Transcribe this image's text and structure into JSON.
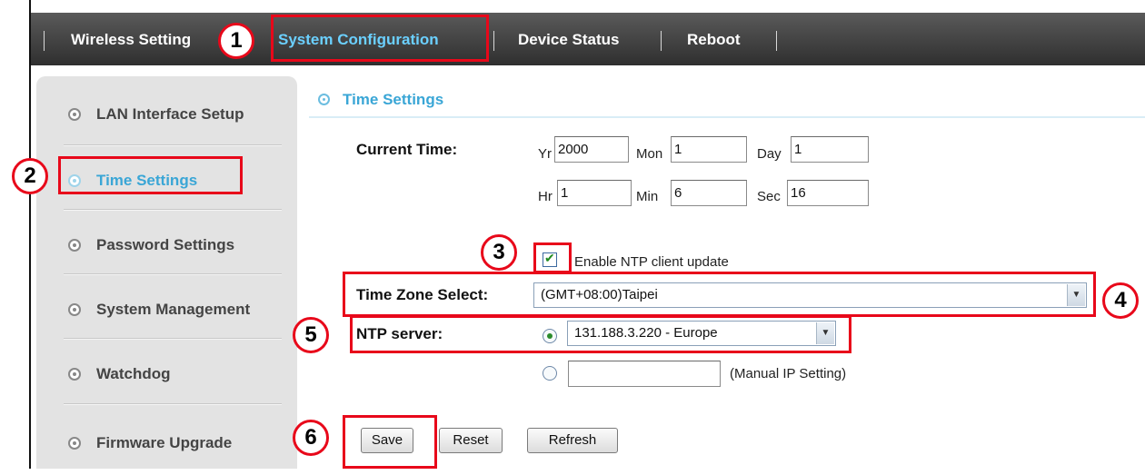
{
  "nav": {
    "items": [
      {
        "label": "Wireless Setting"
      },
      {
        "label": "System Configuration",
        "active": true
      },
      {
        "label": "Device Status"
      },
      {
        "label": "Reboot"
      }
    ]
  },
  "sidebar": {
    "items": [
      {
        "label": "LAN Interface Setup"
      },
      {
        "label": "Time Settings",
        "active": true
      },
      {
        "label": "Password Settings"
      },
      {
        "label": "System Management"
      },
      {
        "label": "Watchdog"
      },
      {
        "label": "Firmware Upgrade"
      }
    ]
  },
  "main": {
    "section_title": "Time Settings",
    "current_time": {
      "label": "Current Time:",
      "yr_label": "Yr",
      "yr": "2000",
      "mon_label": "Mon",
      "mon": "1",
      "day_label": "Day",
      "day": "1",
      "hr_label": "Hr",
      "hr": "1",
      "min_label": "Min",
      "min": "6",
      "sec_label": "Sec",
      "sec": "16"
    },
    "ntp_enable": {
      "label": "Enable NTP client update",
      "checked": true
    },
    "timezone": {
      "label": "Time Zone Select:",
      "value": "(GMT+08:00)Taipei"
    },
    "ntp_server": {
      "label": "NTP server:",
      "value": "131.188.3.220 - Europe",
      "manual_label": "(Manual IP Setting)",
      "manual_value": ""
    },
    "buttons": {
      "save": "Save",
      "reset": "Reset",
      "refresh": "Refresh"
    }
  },
  "callouts": [
    "1",
    "2",
    "3",
    "4",
    "5",
    "6"
  ],
  "colors": {
    "accent": "#3aa6d6",
    "callout": "#e8081a",
    "nav_active": "#6bd0ff"
  }
}
